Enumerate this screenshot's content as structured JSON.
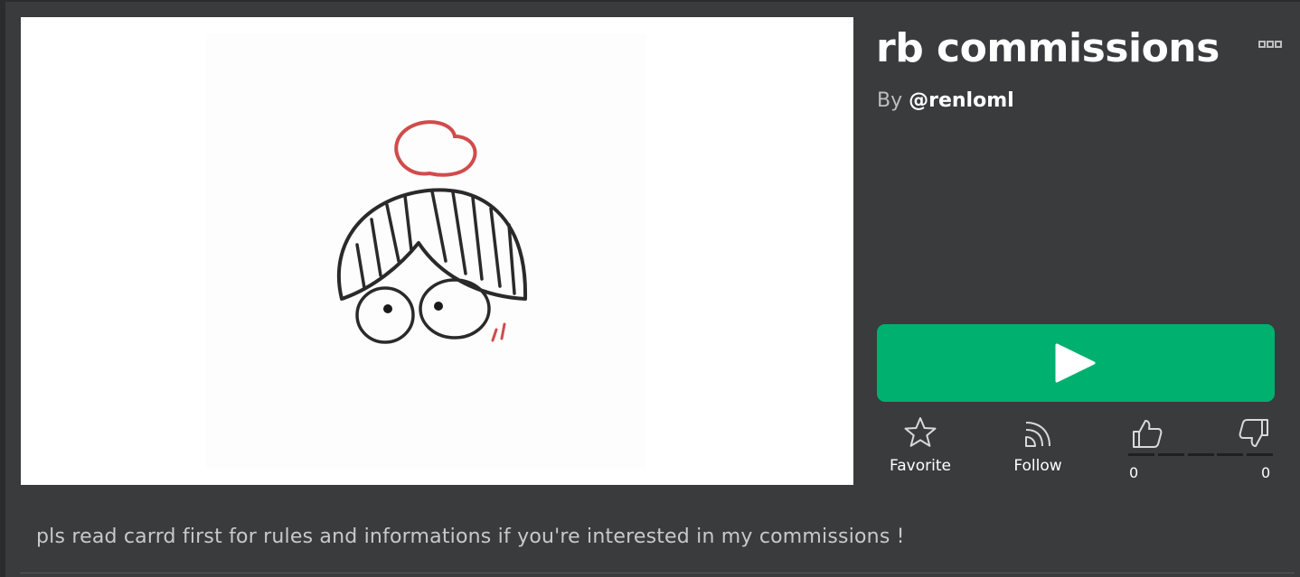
{
  "game": {
    "title": "rb commissions",
    "by_prefix": "By",
    "creator": "@renloml",
    "description": "pls read carrd first for rules and informations if you're interested in my commissions !"
  },
  "actions": {
    "favorite_label": "Favorite",
    "follow_label": "Follow"
  },
  "votes": {
    "up_count": "0",
    "down_count": "0"
  },
  "icons": {
    "more": "more-dots-icon",
    "play": "play-icon",
    "favorite": "star-icon",
    "follow": "rss-icon",
    "upvote": "thumbs-up-icon",
    "downvote": "thumbs-down-icon"
  },
  "colors": {
    "background": "#393b3d",
    "play_button": "#00b06f",
    "text_primary": "#ffffff",
    "text_secondary": "#bdbebe"
  }
}
